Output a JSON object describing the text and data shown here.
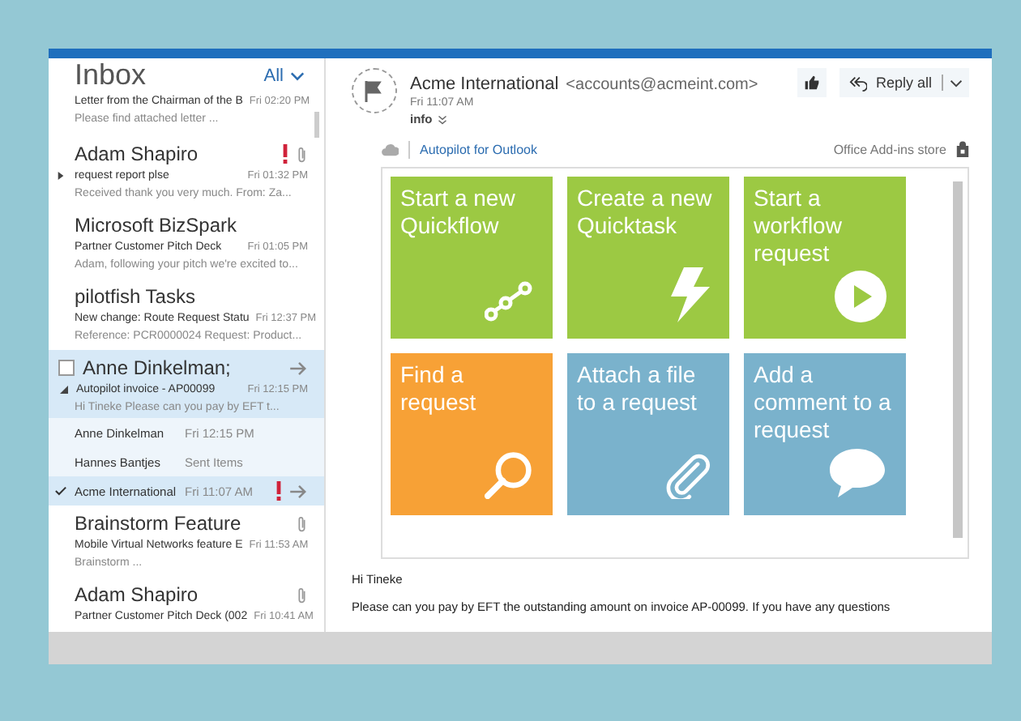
{
  "folder": {
    "title": "Inbox",
    "filter": "All"
  },
  "messages": [
    {
      "kind": "message",
      "subject": "Letter from the Chairman of the B",
      "time": "Fri 02:20 PM",
      "preview": "Please find attached letter ...",
      "important": false,
      "attachment": false,
      "selected": false
    },
    {
      "kind": "message",
      "sender": "Adam Shapiro",
      "subject": "request report plse",
      "time": "Fri 01:32 PM",
      "preview": "Received thank you very much.  From: Za...",
      "important": true,
      "attachment": true,
      "expanded": false,
      "selected": false
    },
    {
      "kind": "message",
      "sender": "Microsoft BizSpark",
      "subject": "Partner Customer Pitch Deck",
      "time": "Fri 01:05 PM",
      "preview": "Adam, following your pitch we're excited to...",
      "important": false,
      "attachment": false,
      "selected": false
    },
    {
      "kind": "message",
      "sender": "pilotfish Tasks",
      "subject": "New change: Route Request Statu",
      "time": "Fri 12:37 PM",
      "preview": "Reference: PCR0000024 Request: Product...",
      "important": false,
      "attachment": false,
      "selected": false
    },
    {
      "kind": "thread",
      "sender": "Anne Dinkelman;",
      "subject": "Autopilot invoice - AP00099",
      "time": "Fri 12:15 PM",
      "preview": "Hi Tineke  Please can you pay by EFT t...",
      "checked": false,
      "forwarded": true,
      "expanded": true,
      "selected": true,
      "children": [
        {
          "name": "Anne Dinkelman",
          "info": "Fri 12:15 PM",
          "selected": false,
          "important": false,
          "forwarded": false
        },
        {
          "name": "Hannes Bantjes",
          "info": "Sent Items",
          "selected": false,
          "important": false,
          "forwarded": false
        },
        {
          "name": "Acme International",
          "info": "Fri 11:07 AM",
          "selected": true,
          "important": true,
          "forwarded": true
        }
      ]
    },
    {
      "kind": "message",
      "sender": "Brainstorm Feature",
      "subject": "Mobile Virtual Networks feature E",
      "time": "Fri 11:53 AM",
      "preview": "Brainstorm ...",
      "important": false,
      "attachment": true,
      "selected": false
    },
    {
      "kind": "message",
      "sender": "Adam Shapiro",
      "subject": "Partner Customer Pitch Deck (002",
      "time": "Fri 10:41 AM",
      "important": false,
      "attachment": true,
      "selected": false
    }
  ],
  "reading": {
    "sender": "Acme International",
    "email": "<accounts@acmeint.com>",
    "time": "Fri 11:07 AM",
    "info": "info",
    "reply": "Reply all",
    "addin": {
      "name": "Autopilot for Outlook",
      "store": "Office Add-ins store",
      "tiles": [
        {
          "label": "Start a new Quickflow",
          "color": "#9cc943"
        },
        {
          "label": "Create a new Quicktask",
          "color": "#9cc943"
        },
        {
          "label": "Start a workflow request",
          "color": "#9cc943"
        },
        {
          "label": "Find a request",
          "color": "#f7a136"
        },
        {
          "label": "Attach a file to a request",
          "color": "#7ab2cc"
        },
        {
          "label": "Add a comment to a request",
          "color": "#7ab2cc"
        }
      ]
    },
    "body": [
      "Hi Tineke",
      "Please can you pay by EFT the outstanding amount on invoice AP-00099.  If you have any questions"
    ]
  }
}
